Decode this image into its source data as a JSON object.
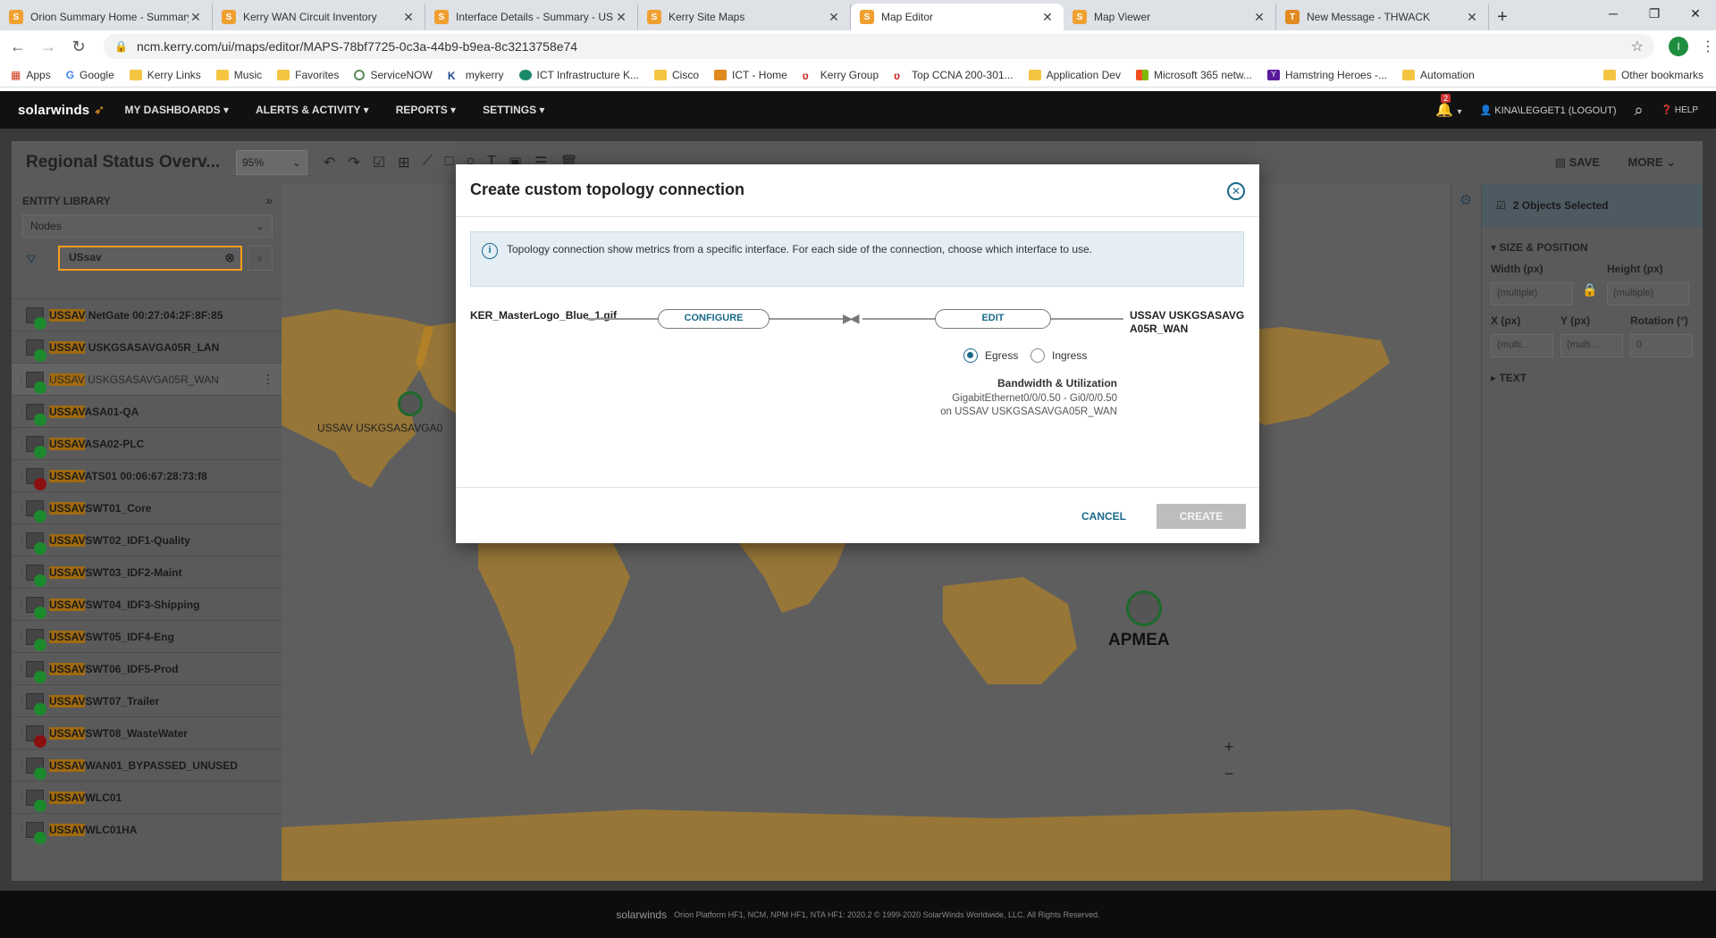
{
  "browser": {
    "tabs": [
      {
        "title": "Orion Summary Home - Summary",
        "active": false
      },
      {
        "title": "Kerry WAN Circuit Inventory",
        "active": false
      },
      {
        "title": "Interface Details - Summary - US",
        "active": false
      },
      {
        "title": "Kerry Site Maps",
        "active": false
      },
      {
        "title": "Map Editor",
        "active": true
      },
      {
        "title": "Map Viewer",
        "active": false
      },
      {
        "title": "New Message - THWACK",
        "active": false
      }
    ],
    "new_tab": "+",
    "url": "ncm.kerry.com/ui/maps/editor/MAPS-78bf7725-0c3a-44b9-b9ea-8c3213758e74",
    "profile_initial": "I",
    "bookmarks": [
      "Apps",
      "Google",
      "Kerry Links",
      "Music",
      "Favorites",
      "ServiceNOW",
      "mykerry",
      "ICT Infrastructure K...",
      "Cisco",
      "ICT - Home",
      "Kerry Group",
      "Top CCNA 200-301...",
      "Application Dev",
      "Microsoft 365 netw...",
      "Hamstring Heroes -...",
      "Automation"
    ],
    "bookmarks_more": "»",
    "other_bookmarks": "Other bookmarks"
  },
  "header": {
    "logo": "solarwinds",
    "menus": [
      "MY DASHBOARDS",
      "ALERTS & ACTIVITY",
      "REPORTS",
      "SETTINGS"
    ],
    "alert_count": "2",
    "user": "KINA\\LEGGET1 (LOGOUT)",
    "help": "HELP"
  },
  "toolbar": {
    "map_title": "Regional Status Overv...",
    "zoom": "95%",
    "save": "SAVE",
    "more": "MORE"
  },
  "entity_library": {
    "title": "ENTITY LIBRARY",
    "type": "Nodes",
    "search": "USsav",
    "nodes": [
      {
        "prefix": "USSAV",
        "rest": " NetGate 00:27:04:2F:8F:85",
        "status": "up"
      },
      {
        "prefix": "USSAV",
        "rest": " USKGSASAVGA05R_LAN",
        "status": "up"
      },
      {
        "prefix": "USSAV",
        "rest": " USKGSASAVGA05R_WAN",
        "status": "up",
        "selected": true
      },
      {
        "prefix": "USSAV",
        "rest": "ASA01-QA",
        "status": "up"
      },
      {
        "prefix": "USSAV",
        "rest": "ASA02-PLC",
        "status": "up"
      },
      {
        "prefix": "USSAV",
        "rest": "ATS01 00:06:67:28:73:f8",
        "status": "down"
      },
      {
        "prefix": "USSAV",
        "rest": "SWT01_Core",
        "status": "up"
      },
      {
        "prefix": "USSAV",
        "rest": "SWT02_IDF1-Quality",
        "status": "up"
      },
      {
        "prefix": "USSAV",
        "rest": "SWT03_IDF2-Maint",
        "status": "up"
      },
      {
        "prefix": "USSAV",
        "rest": "SWT04_IDF3-Shipping",
        "status": "up"
      },
      {
        "prefix": "USSAV",
        "rest": "SWT05_IDF4-Eng",
        "status": "up"
      },
      {
        "prefix": "USSAV",
        "rest": "SWT06_IDF5-Prod",
        "status": "up"
      },
      {
        "prefix": "USSAV",
        "rest": "SWT07_Trailer",
        "status": "up"
      },
      {
        "prefix": "USSAV",
        "rest": "SWT08_WasteWater",
        "status": "down"
      },
      {
        "prefix": "USSAV",
        "rest": "WAN01_BYPASSED_UNUSED",
        "status": "up"
      },
      {
        "prefix": "USSAV",
        "rest": "WLC01",
        "status": "up"
      },
      {
        "prefix": "USSAV",
        "rest": "WLC01HA",
        "status": "up"
      }
    ]
  },
  "map": {
    "node_label_left": "USSAV USKGSASAVGA0",
    "node_label_apmea": "APMEA",
    "land_color": "#c68a1a",
    "zoom_in": "+",
    "zoom_out": "−"
  },
  "right_panel": {
    "selected": "2 Objects Selected",
    "size_position": "SIZE & POSITION",
    "width_label": "Width (px)",
    "height_label": "Height (px)",
    "width_val": "(multiple)",
    "height_val": "(multiple)",
    "x_label": "X (px)",
    "y_label": "Y (px)",
    "rotation_label": "Rotation (°)",
    "x_val": "(multi...",
    "y_val": "(multi...",
    "rotation_val": "0",
    "text": "TEXT"
  },
  "modal": {
    "title": "Create custom topology connection",
    "info": "Topology connection show metrics from a specific interface. For each side of the connection, choose which interface to use.",
    "source": "KER_MasterLogo_Blue_1.gif",
    "configure": "CONFIGURE",
    "edit": "EDIT",
    "destination": "USSAV USKGSASAVGA05R_WAN",
    "egress": "Egress",
    "ingress": "Ingress",
    "bw_title": "Bandwidth & Utilization",
    "bw_iface": "GigabitEthernet0/0/0.50 - Gi0/0/0.50",
    "bw_node": "on USSAV USKGSASAVGA05R_WAN",
    "cancel": "CANCEL",
    "create": "CREATE"
  },
  "footer": {
    "logo": "solarwinds",
    "text": "Orion Platform HF1, NCM, NPM HF1, NTA HF1: 2020.2 © 1999-2020 SolarWinds Worldwide, LLC. All Rights Reserved."
  }
}
